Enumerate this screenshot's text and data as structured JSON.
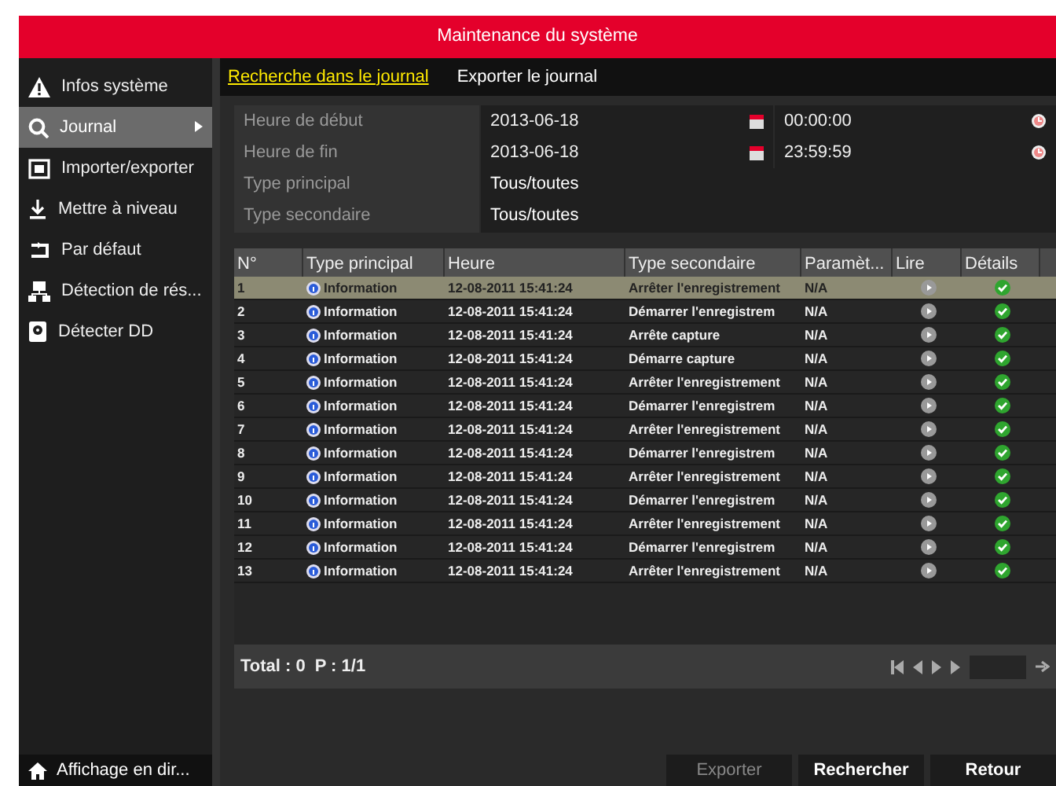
{
  "window": {
    "title": "Maintenance du système"
  },
  "sidebar": {
    "items": [
      {
        "label": "Infos système",
        "selected": false
      },
      {
        "label": "Journal",
        "selected": true
      },
      {
        "label": "Importer/exporter",
        "selected": false
      },
      {
        "label": "Mettre à niveau",
        "selected": false
      },
      {
        "label": "Par défaut",
        "selected": false
      },
      {
        "label": "Détection de rés...",
        "selected": false
      },
      {
        "label": "Détecter DD",
        "selected": false
      }
    ],
    "footer": {
      "label": "Affichage en dir..."
    }
  },
  "tabs": [
    {
      "label": "Recherche dans le journal",
      "selected": true
    },
    {
      "label": "Exporter le journal",
      "selected": false
    }
  ],
  "filters": [
    {
      "kind": "datetime",
      "label": "Heure de début",
      "date": "2013-06-18",
      "time": "00:00:00"
    },
    {
      "kind": "datetime",
      "label": "Heure de fin",
      "date": "2013-06-18",
      "time": "23:59:59"
    },
    {
      "kind": "select",
      "label": "Type principal",
      "value": "Tous/toutes"
    },
    {
      "kind": "select",
      "label": "Type secondaire",
      "value": "Tous/toutes"
    }
  ],
  "table": {
    "columns": [
      "N°",
      "Type principal",
      "Heure",
      "Type secondaire",
      "Paramèt...",
      "Lire",
      "Détails"
    ],
    "rows": [
      {
        "no": "1",
        "type": "Information",
        "time": "12-08-2011 15:41:24",
        "subtype": "Arrêter l'enregistrement",
        "param": "N/A",
        "selected": true
      },
      {
        "no": "2",
        "type": "Information",
        "time": "12-08-2011 15:41:24",
        "subtype": "Démarrer l'enregistrem",
        "param": "N/A",
        "selected": false
      },
      {
        "no": "3",
        "type": "Information",
        "time": "12-08-2011 15:41:24",
        "subtype": "Arrête capture",
        "param": "N/A",
        "selected": false
      },
      {
        "no": "4",
        "type": "Information",
        "time": "12-08-2011 15:41:24",
        "subtype": "Démarre capture",
        "param": "N/A",
        "selected": false
      },
      {
        "no": "5",
        "type": "Information",
        "time": "12-08-2011 15:41:24",
        "subtype": "Arrêter l'enregistrement",
        "param": "N/A",
        "selected": false
      },
      {
        "no": "6",
        "type": "Information",
        "time": "12-08-2011 15:41:24",
        "subtype": "Démarrer l'enregistrem",
        "param": "N/A",
        "selected": false
      },
      {
        "no": "7",
        "type": "Information",
        "time": "12-08-2011 15:41:24",
        "subtype": "Arrêter l'enregistrement",
        "param": "N/A",
        "selected": false
      },
      {
        "no": "8",
        "type": "Information",
        "time": "12-08-2011 15:41:24",
        "subtype": "Démarrer l'enregistrem",
        "param": "N/A",
        "selected": false
      },
      {
        "no": "9",
        "type": "Information",
        "time": "12-08-2011 15:41:24",
        "subtype": "Arrêter l'enregistrement",
        "param": "N/A",
        "selected": false
      },
      {
        "no": "10",
        "type": "Information",
        "time": "12-08-2011 15:41:24",
        "subtype": "Démarrer l'enregistrem",
        "param": "N/A",
        "selected": false
      },
      {
        "no": "11",
        "type": "Information",
        "time": "12-08-2011 15:41:24",
        "subtype": "Arrêter l'enregistrement",
        "param": "N/A",
        "selected": false
      },
      {
        "no": "12",
        "type": "Information",
        "time": "12-08-2011 15:41:24",
        "subtype": "Démarrer l'enregistrem",
        "param": "N/A",
        "selected": false
      },
      {
        "no": "13",
        "type": "Information",
        "time": "12-08-2011 15:41:24",
        "subtype": "Arrêter l'enregistrement",
        "param": "N/A",
        "selected": false
      }
    ]
  },
  "pagination": {
    "total": "Total : 0",
    "page": "P : 1/1"
  },
  "buttons": [
    {
      "label": "Exporter",
      "disabled": true
    },
    {
      "label": "Rechercher",
      "disabled": false
    },
    {
      "label": "Retour",
      "disabled": false
    }
  ]
}
